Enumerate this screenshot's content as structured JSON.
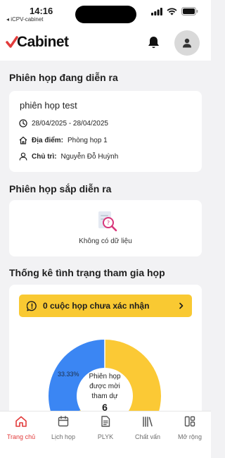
{
  "status_bar": {
    "time": "14:16",
    "back_app": "◂ iCPV-cabinet"
  },
  "header": {
    "logo_text": "Cabinet"
  },
  "ongoing": {
    "title": "Phiên họp đang diễn ra",
    "meeting": {
      "name": "phiên họp test",
      "dates": "28/04/2025 - 28/04/2025",
      "location_label": "Địa điểm:",
      "location": "Phòng họp 1",
      "chair_label": "Chủ trì:",
      "chair": "Nguyễn Đỗ Huỳnh"
    }
  },
  "upcoming": {
    "title": "Phiên họp sắp diễn ra",
    "empty_text": "Không có dữ liệu"
  },
  "stats": {
    "title": "Thống kê tình trạng tham gia họp",
    "unconfirmed_label": "0 cuộc họp chưa xác nhận",
    "donut_label_lines": [
      "Phiên họp",
      "được mời",
      "tham dự"
    ],
    "donut_total": "6",
    "left_pct_label": "33.33%",
    "segments": [
      {
        "fraction": 0.3333,
        "color": "#3b86f3"
      },
      {
        "fraction": 0.6667,
        "color": "#fbc935"
      }
    ]
  },
  "tabs": [
    {
      "label": "Trang chủ",
      "icon": "home-icon"
    },
    {
      "label": "Lịch họp",
      "icon": "calendar-icon"
    },
    {
      "label": "PLYK",
      "icon": "document-icon"
    },
    {
      "label": "Chất vấn",
      "icon": "library-icon"
    },
    {
      "label": "Mở rộng",
      "icon": "grid-icon"
    }
  ],
  "colors": {
    "accent": "#e23b3b",
    "unconfirmed_bg": "#f9c932",
    "donut_blue": "#3b86f3",
    "donut_yellow": "#fbc935"
  }
}
